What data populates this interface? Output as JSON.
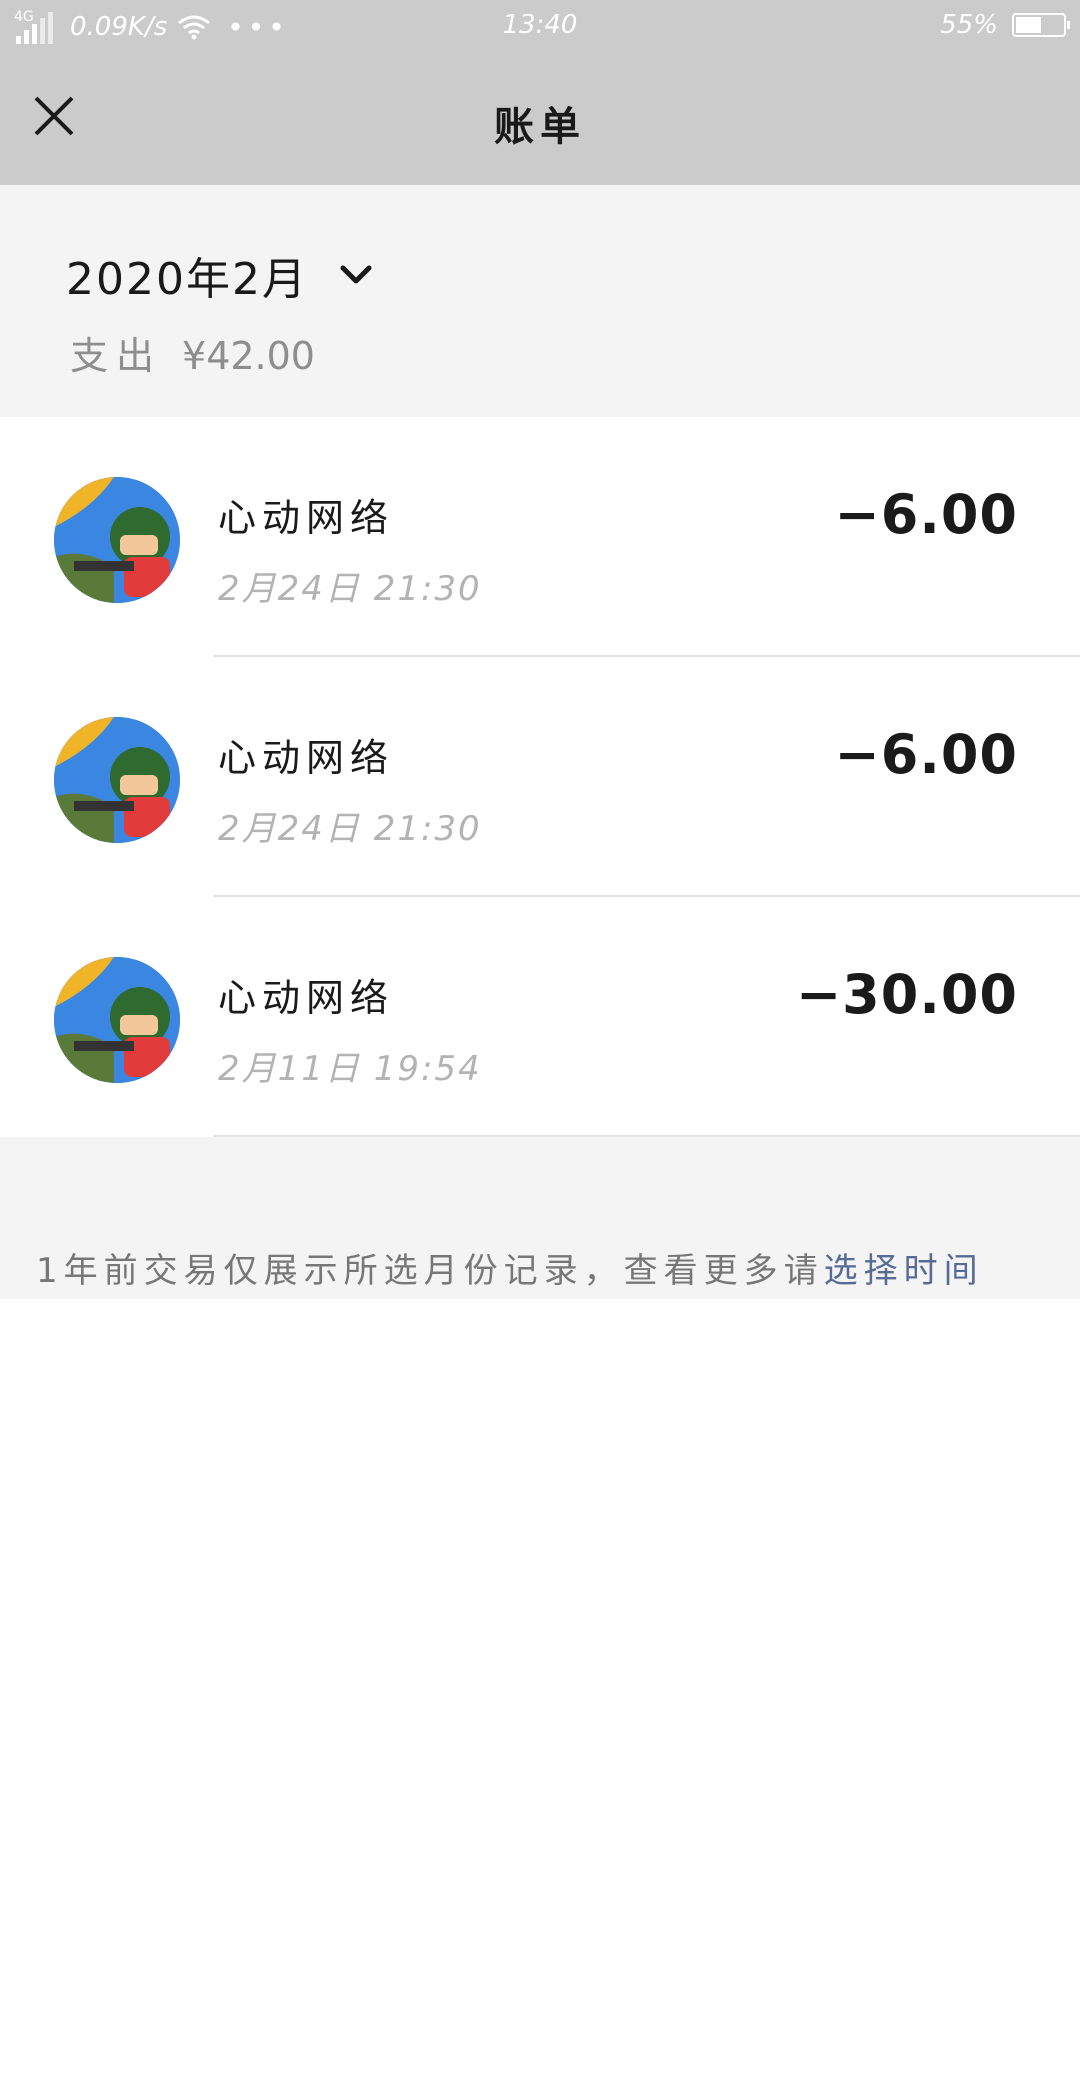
{
  "status_bar": {
    "network": "4G",
    "speed": "0.09K/s",
    "time": "13:40",
    "battery_percent": "55%",
    "battery_level": 0.55
  },
  "nav": {
    "title": "账单"
  },
  "month": {
    "label": "2020年2月",
    "expense_label": "支出",
    "expense_amount": "¥42.00"
  },
  "transactions": [
    {
      "merchant": "心动网络",
      "datetime": "2月24日 21:30",
      "amount": "−6.00"
    },
    {
      "merchant": "心动网络",
      "datetime": "2月24日 21:30",
      "amount": "−6.00"
    },
    {
      "merchant": "心动网络",
      "datetime": "2月11日 19:54",
      "amount": "−30.00"
    }
  ],
  "footer": {
    "note": "1年前交易仅展示所选月份记录，查看更多请",
    "link": "选择时间"
  }
}
